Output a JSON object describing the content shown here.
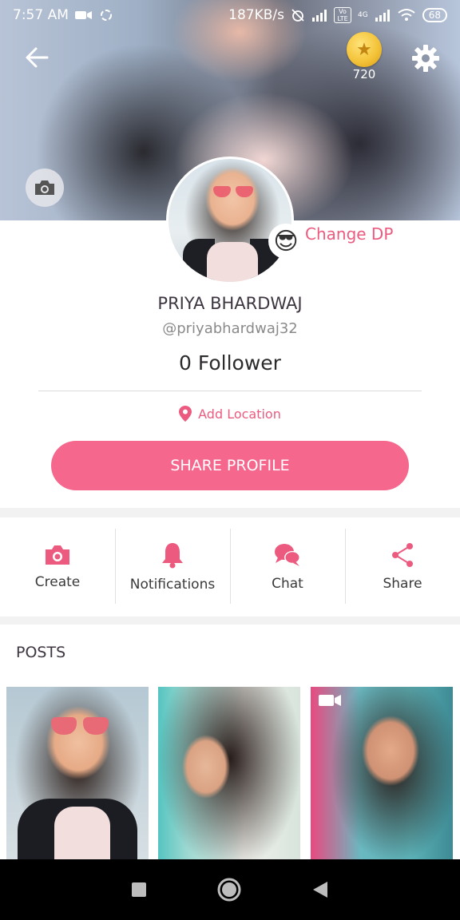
{
  "status_bar": {
    "time": "7:57 AM",
    "net_speed": "187KB/s",
    "network": "4G",
    "volte": "Vo LTE",
    "battery": "68"
  },
  "header": {
    "coin_count": "720"
  },
  "profile": {
    "change_dp_label": "Change DP",
    "name": "PRIYA BHARDWAJ",
    "handle": "@priyabhardwaj32",
    "followers": "0 Follower",
    "location_label": "Add Location",
    "share_button": "SHARE PROFILE"
  },
  "actions": [
    {
      "label": "Create",
      "icon": "camera-icon"
    },
    {
      "label": "Notifications",
      "icon": "bell-icon"
    },
    {
      "label": "Chat",
      "icon": "chat-bubbles-icon"
    },
    {
      "label": "Share",
      "icon": "share-icon"
    }
  ],
  "posts": {
    "title": "POSTS"
  },
  "colors": {
    "accent": "#f5678c",
    "accent_text": "#ec5b7f"
  }
}
